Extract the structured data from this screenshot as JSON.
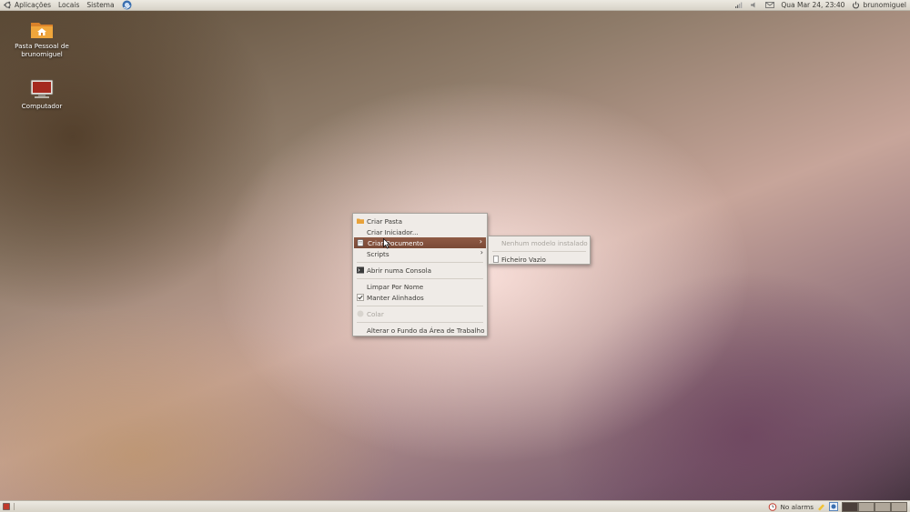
{
  "top_panel": {
    "applications": "Aplicações",
    "places": "Locais",
    "system": "Sistema",
    "datetime": "Qua Mar 24, 23:40",
    "username": "brunomiguel"
  },
  "desktop": {
    "home_folder_label": "Pasta Pessoal de brunomiguel",
    "computer_label": "Computador"
  },
  "context_menu": {
    "create_folder": "Criar Pasta",
    "create_launcher": "Criar Iniciador...",
    "create_document": "Criar Documento",
    "scripts": "Scripts",
    "open_terminal": "Abrir numa Consola",
    "clean_by_name": "Limpar Por Nome",
    "keep_aligned": "Manter Alinhados",
    "paste": "Colar",
    "change_background": "Alterar o Fundo da Área de Trabalho"
  },
  "submenu": {
    "no_templates": "Nenhum modelo instalado",
    "empty_file": "Ficheiro Vazio"
  },
  "bottom_panel": {
    "alarms": "No alarms"
  },
  "colors": {
    "highlight": "#7a4a36",
    "panel": "#dfdbd2",
    "folder_orange": "#e8902c"
  }
}
